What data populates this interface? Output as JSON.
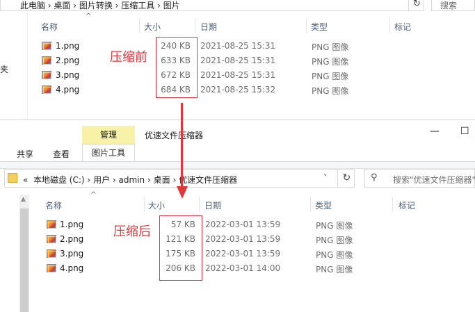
{
  "top_window": {
    "breadcrumb": "此电脑 › 桌面 › 图片转换 › 压缩工具 › 图片",
    "search_placeholder": "搜索",
    "left_pane_stub": "夹",
    "columns": {
      "name": "名称",
      "size": "大小",
      "date": "日期",
      "type": "类型",
      "tags": "标记"
    },
    "files": [
      {
        "name": "1.png",
        "size": "240 KB",
        "date": "2021-08-25 15:31",
        "type": "PNG 图像"
      },
      {
        "name": "2.png",
        "size": "633 KB",
        "date": "2021-08-25 15:31",
        "type": "PNG 图像"
      },
      {
        "name": "3.png",
        "size": "672 KB",
        "date": "2021-08-25 15:31",
        "type": "PNG 图像"
      },
      {
        "name": "4.png",
        "size": "684 KB",
        "date": "2021-08-25 15:32",
        "type": "PNG 图像"
      }
    ]
  },
  "annotations": {
    "before": "压缩前",
    "after": "压缩后",
    "color": "#e0373a"
  },
  "bottom_window": {
    "manage_tab": "管理",
    "title": "优速文件压缩器",
    "tabs": [
      "共享",
      "查看"
    ],
    "active_tab": "图片工具",
    "window_controls": {
      "minimize": "—",
      "maximize": "☐"
    },
    "breadcrumb": {
      "back": "«",
      "items": [
        "本地磁盘 (C:)",
        "用户",
        "admin",
        "桌面",
        "优速文件压缩器"
      ],
      "separator": "›"
    },
    "search_placeholder": "搜索\"优速文件压缩器\"",
    "columns": {
      "name": "名称",
      "size": "大小",
      "date": "日期",
      "type": "类型",
      "tags": "标记"
    },
    "files": [
      {
        "name": "1.png",
        "size": "57 KB",
        "date": "2022-03-01 13:59",
        "type": "PNG 图像"
      },
      {
        "name": "2.png",
        "size": "121 KB",
        "date": "2022-03-01 13:59",
        "type": "PNG 图像"
      },
      {
        "name": "3.png",
        "size": "175 KB",
        "date": "2022-03-01 13:59",
        "type": "PNG 图像"
      },
      {
        "name": "4.png",
        "size": "206 KB",
        "date": "2022-03-01 14:00",
        "type": "PNG 图像"
      }
    ]
  },
  "icons": {
    "refresh": "↻",
    "search": "⚲",
    "sort_up": "^",
    "chevron_down": "˅",
    "scroll_up": "▲"
  },
  "colors": {
    "manage_tab_bg": "#f7f2a8",
    "header_text": "#4c607a"
  }
}
